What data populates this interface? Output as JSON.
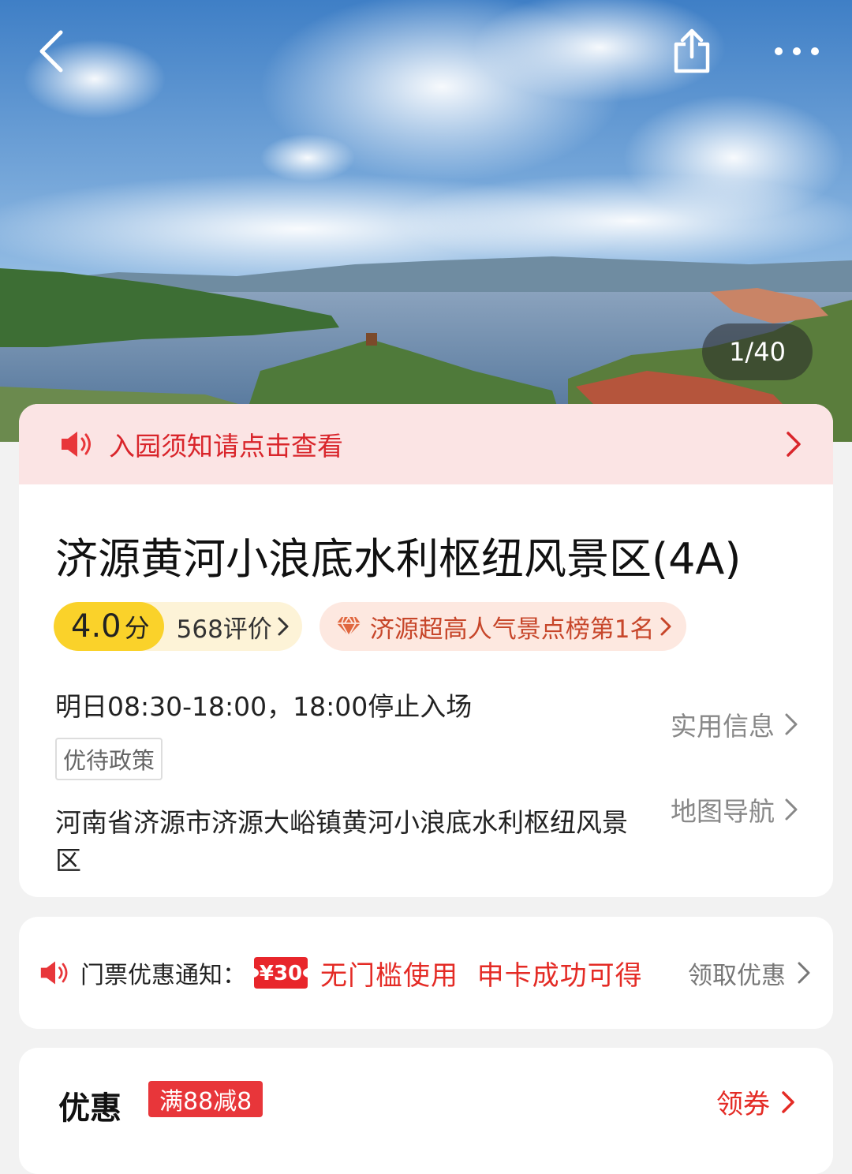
{
  "header": {
    "back_icon": "back-arrow-icon",
    "share_icon": "share-icon",
    "more_icon": "more-icon",
    "photo_counter": "1/40"
  },
  "notice": {
    "text": "入园须知请点击查看",
    "icon": "speaker-icon"
  },
  "scenic": {
    "title": "济源黄河小浪底水利枢纽风景区(4A)",
    "score": "4.0",
    "score_unit": "分",
    "reviews": "568评价",
    "rank": "济源超高人气景点榜第1名",
    "hours": "明日08:30-18:00，18:00停止入场",
    "policy_tag": "优待政策",
    "useful_info": "实用信息",
    "address": "河南省济源市济源大峪镇黄河小浪底水利枢纽风景区",
    "map_nav": "地图导航"
  },
  "ticket_promo": {
    "label": "门票优惠通知：",
    "coupon_amount": "¥30",
    "text": "无门槛使用  申卡成功可得",
    "action": "领取优惠"
  },
  "discount": {
    "title": "优惠",
    "tag": "满88减8",
    "action": "领券"
  },
  "colors": {
    "accent_red": "#e42b25",
    "score_yellow": "#fad22a",
    "notice_bg": "#fbe4e4"
  }
}
